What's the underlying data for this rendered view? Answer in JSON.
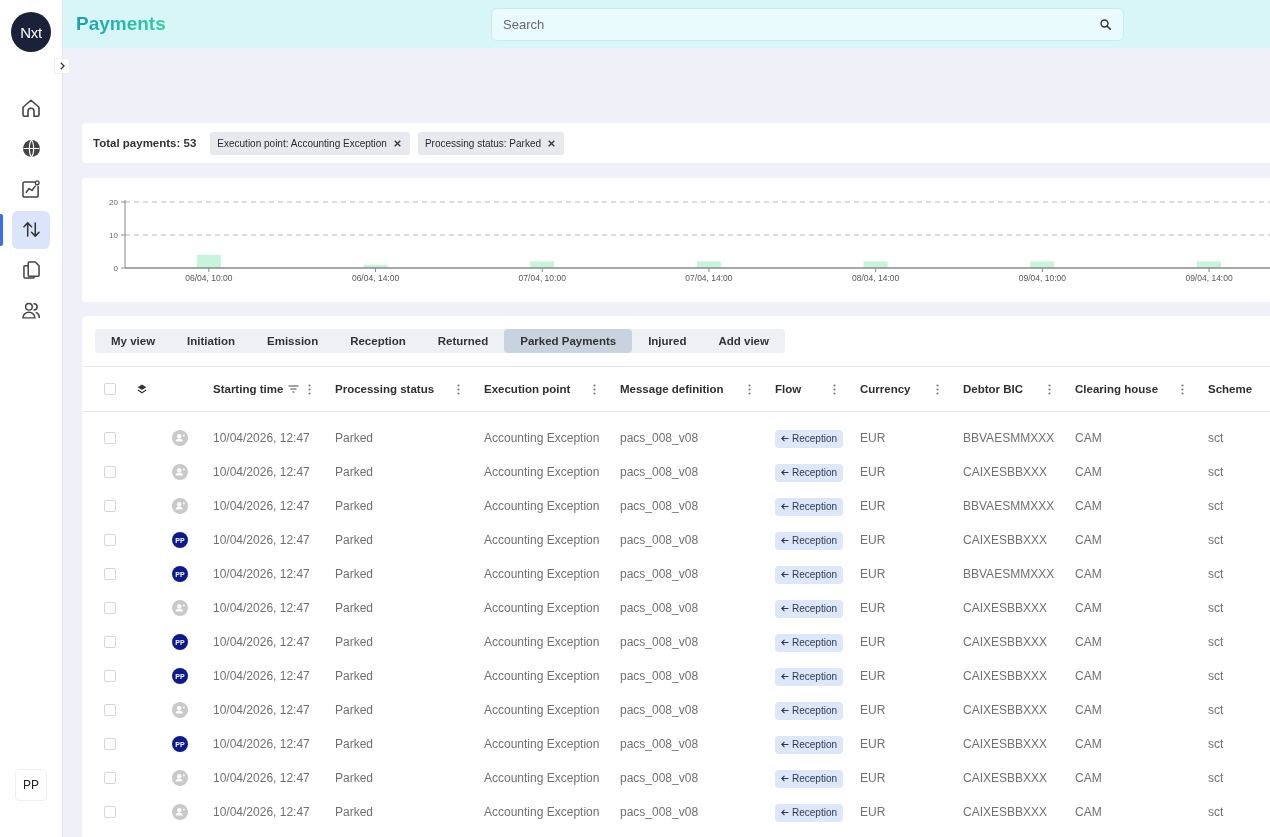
{
  "sidebar": {
    "logo": "Nxt",
    "nav": [
      {
        "selected": false
      },
      {
        "selected": false
      },
      {
        "selected": false
      },
      {
        "selected": true
      },
      {
        "selected": false
      },
      {
        "selected": false
      }
    ],
    "user": "PP"
  },
  "header": {
    "title": "Payments",
    "search": {
      "placeholder": "Search"
    }
  },
  "summary": {
    "total": "Total payments: 53",
    "filters": [
      "Execution point: Accounting Exception",
      "Processing status: Parked"
    ]
  },
  "chart": {
    "chart_data": {
      "type": "bar",
      "categories": [
        "06/04, 10:00",
        "06/04, 14:00",
        "07/04, 10:00",
        "07/04, 14:00",
        "08/04, 14:00",
        "09/04, 10:00",
        "09/04, 14:00"
      ],
      "series": [
        {
          "color": "#c6f5dc",
          "values": [
            4,
            1,
            2,
            2,
            2,
            2,
            2
          ]
        }
      ],
      "ylim": [
        0,
        20
      ],
      "yticks": [
        0,
        10,
        20
      ]
    }
  },
  "views": {
    "tabs": [
      {
        "label": "My view",
        "selected": false
      },
      {
        "label": "Initiation",
        "selected": false
      },
      {
        "label": "Emission",
        "selected": false
      },
      {
        "label": "Reception",
        "selected": false
      },
      {
        "label": "Returned",
        "selected": false
      },
      {
        "label": "Parked Payments",
        "selected": true
      },
      {
        "label": "Injured",
        "selected": false
      },
      {
        "label": "Add view",
        "selected": false
      }
    ]
  },
  "table": {
    "select_all": {
      "checked": false
    },
    "columns": [
      {
        "label": "Starting time",
        "sorted": true,
        "menu": true
      },
      {
        "label": "Processing status",
        "sorted": false,
        "menu": true
      },
      {
        "label": "Execution point",
        "sorted": false,
        "menu": true
      },
      {
        "label": "Message definition",
        "sorted": false,
        "menu": true
      },
      {
        "label": "Flow",
        "sorted": false,
        "menu": true
      },
      {
        "label": "Currency",
        "sorted": false,
        "menu": true
      },
      {
        "label": "Debtor BIC",
        "sorted": false,
        "menu": true
      },
      {
        "label": "Clearing house",
        "sorted": false,
        "menu": true
      },
      {
        "label": "Scheme",
        "sorted": false,
        "menu": false
      }
    ],
    "rows": [
      {
        "checked": false,
        "owner": {
          "kind": "unassigned"
        },
        "starting_time": "10/04/2026, 12:47",
        "processing_status": "Parked",
        "execution_point": "Accounting Exception",
        "message_definition": "pacs_008_v08",
        "flow": "Reception",
        "currency": "EUR",
        "debtor_bic": "BBVAESMMXXX",
        "clearing_house": "CAM",
        "scheme": "sct"
      },
      {
        "checked": false,
        "owner": {
          "kind": "unassigned"
        },
        "starting_time": "10/04/2026, 12:47",
        "processing_status": "Parked",
        "execution_point": "Accounting Exception",
        "message_definition": "pacs_008_v08",
        "flow": "Reception",
        "currency": "EUR",
        "debtor_bic": "CAIXESBBXXX",
        "clearing_house": "CAM",
        "scheme": "sct"
      },
      {
        "checked": false,
        "owner": {
          "kind": "unassigned"
        },
        "starting_time": "10/04/2026, 12:47",
        "processing_status": "Parked",
        "execution_point": "Accounting Exception",
        "message_definition": "pacs_008_v08",
        "flow": "Reception",
        "currency": "EUR",
        "debtor_bic": "BBVAESMMXXX",
        "clearing_house": "CAM",
        "scheme": "sct"
      },
      {
        "checked": false,
        "owner": {
          "kind": "initials",
          "label": "PP"
        },
        "starting_time": "10/04/2026, 12:47",
        "processing_status": "Parked",
        "execution_point": "Accounting Exception",
        "message_definition": "pacs_008_v08",
        "flow": "Reception",
        "currency": "EUR",
        "debtor_bic": "CAIXESBBXXX",
        "clearing_house": "CAM",
        "scheme": "sct"
      },
      {
        "checked": false,
        "owner": {
          "kind": "initials",
          "label": "PP"
        },
        "starting_time": "10/04/2026, 12:47",
        "processing_status": "Parked",
        "execution_point": "Accounting Exception",
        "message_definition": "pacs_008_v08",
        "flow": "Reception",
        "currency": "EUR",
        "debtor_bic": "BBVAESMMXXX",
        "clearing_house": "CAM",
        "scheme": "sct"
      },
      {
        "checked": false,
        "owner": {
          "kind": "unassigned"
        },
        "starting_time": "10/04/2026, 12:47",
        "processing_status": "Parked",
        "execution_point": "Accounting Exception",
        "message_definition": "pacs_008_v08",
        "flow": "Reception",
        "currency": "EUR",
        "debtor_bic": "CAIXESBBXXX",
        "clearing_house": "CAM",
        "scheme": "sct"
      },
      {
        "checked": false,
        "owner": {
          "kind": "initials",
          "label": "PP"
        },
        "starting_time": "10/04/2026, 12:47",
        "processing_status": "Parked",
        "execution_point": "Accounting Exception",
        "message_definition": "pacs_008_v08",
        "flow": "Reception",
        "currency": "EUR",
        "debtor_bic": "CAIXESBBXXX",
        "clearing_house": "CAM",
        "scheme": "sct"
      },
      {
        "checked": false,
        "owner": {
          "kind": "initials",
          "label": "PP"
        },
        "starting_time": "10/04/2026, 12:47",
        "processing_status": "Parked",
        "execution_point": "Accounting Exception",
        "message_definition": "pacs_008_v08",
        "flow": "Reception",
        "currency": "EUR",
        "debtor_bic": "CAIXESBBXXX",
        "clearing_house": "CAM",
        "scheme": "sct"
      },
      {
        "checked": false,
        "owner": {
          "kind": "unassigned"
        },
        "starting_time": "10/04/2026, 12:47",
        "processing_status": "Parked",
        "execution_point": "Accounting Exception",
        "message_definition": "pacs_008_v08",
        "flow": "Reception",
        "currency": "EUR",
        "debtor_bic": "CAIXESBBXXX",
        "clearing_house": "CAM",
        "scheme": "sct"
      },
      {
        "checked": false,
        "owner": {
          "kind": "initials",
          "label": "PP"
        },
        "starting_time": "10/04/2026, 12:47",
        "processing_status": "Parked",
        "execution_point": "Accounting Exception",
        "message_definition": "pacs_008_v08",
        "flow": "Reception",
        "currency": "EUR",
        "debtor_bic": "CAIXESBBXXX",
        "clearing_house": "CAM",
        "scheme": "sct"
      },
      {
        "checked": false,
        "owner": {
          "kind": "unassigned"
        },
        "starting_time": "10/04/2026, 12:47",
        "processing_status": "Parked",
        "execution_point": "Accounting Exception",
        "message_definition": "pacs_008_v08",
        "flow": "Reception",
        "currency": "EUR",
        "debtor_bic": "CAIXESBBXXX",
        "clearing_house": "CAM",
        "scheme": "sct"
      },
      {
        "checked": false,
        "owner": {
          "kind": "unassigned"
        },
        "starting_time": "10/04/2026, 12:47",
        "processing_status": "Parked",
        "execution_point": "Accounting Exception",
        "message_definition": "pacs_008_v08",
        "flow": "Reception",
        "currency": "EUR",
        "debtor_bic": "CAIXESBBXXX",
        "clearing_house": "CAM",
        "scheme": "sct"
      }
    ]
  }
}
